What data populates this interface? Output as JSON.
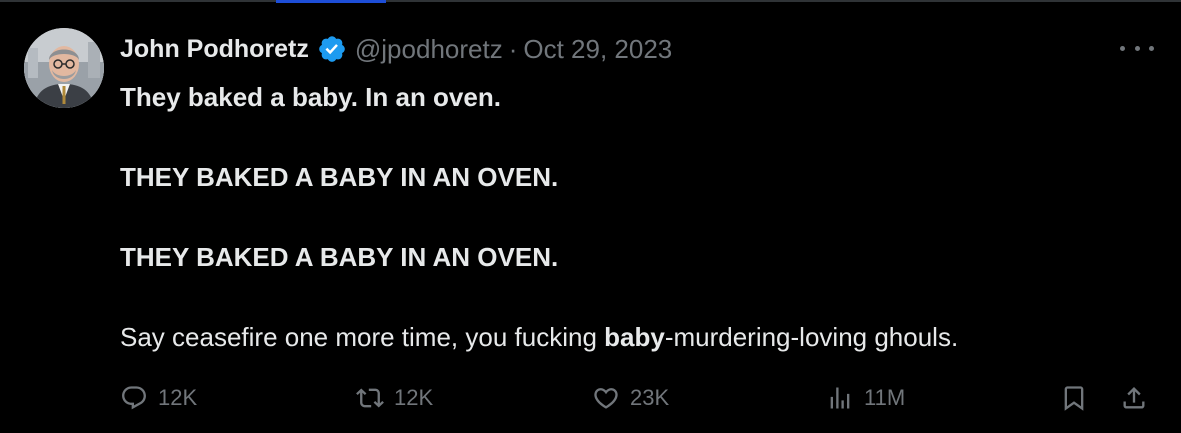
{
  "author": {
    "name": "John Podhoretz",
    "handle": "@jpodhoretz",
    "separator": "·",
    "date": "Oct 29, 2023",
    "verified": true
  },
  "tweet": {
    "line1": "They baked a baby. In an oven.",
    "line2": "THEY BAKED A BABY IN AN OVEN.",
    "line3": "THEY BAKED A BABY IN AN OVEN.",
    "line4_start": "Say ceasefire one more time, you fucking ",
    "line4_bold": "baby",
    "line4_end": "-murdering-loving ghouls."
  },
  "actions": {
    "replies": "12K",
    "reposts": "12K",
    "likes": "23K",
    "views": "11M"
  },
  "colors": {
    "background": "#000000",
    "text": "#e7e9ea",
    "muted": "#71767b",
    "verified_badge": "#1d9bf0"
  },
  "icons": [
    "more-icon",
    "verified-badge-icon",
    "reply-icon",
    "repost-icon",
    "like-icon",
    "views-icon",
    "bookmark-icon",
    "share-icon"
  ]
}
